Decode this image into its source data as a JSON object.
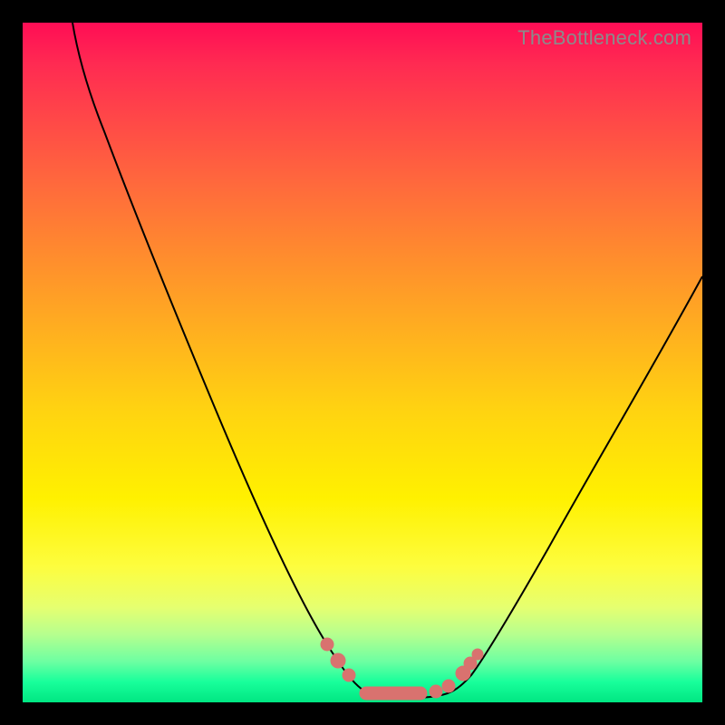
{
  "attribution": "TheBottleneck.com",
  "colors": {
    "frame": "#000000",
    "curve": "#000000",
    "dots": "#d9726f",
    "gradient_top": "#ff0d55",
    "gradient_bottom": "#00e682"
  },
  "chart_data": {
    "type": "line",
    "title": "",
    "xlabel": "",
    "ylabel": "",
    "xlim": [
      0,
      100
    ],
    "ylim": [
      0,
      100
    ],
    "x": [
      0,
      5,
      10,
      15,
      20,
      25,
      30,
      35,
      40,
      45,
      48,
      50,
      52,
      55,
      58,
      60,
      62,
      65,
      70,
      75,
      80,
      85,
      90,
      95,
      100
    ],
    "values": [
      100,
      89,
      78,
      67,
      56,
      45,
      35,
      25,
      16,
      8,
      4,
      2,
      1,
      0.5,
      0.5,
      1,
      2,
      4,
      9,
      16,
      24,
      33,
      42,
      52,
      63
    ],
    "note": "V-shaped bottleneck curve; minimum ~0% near x≈55–58. Y is percentage mismatch (top=100%, bottom=0%). No axis ticks or legend shown.",
    "highlight_points_x": [
      44,
      47,
      50,
      53,
      56,
      59,
      62,
      64
    ],
    "highlight_points_y": [
      9,
      5,
      2,
      1,
      0.5,
      1,
      3,
      6
    ]
  }
}
